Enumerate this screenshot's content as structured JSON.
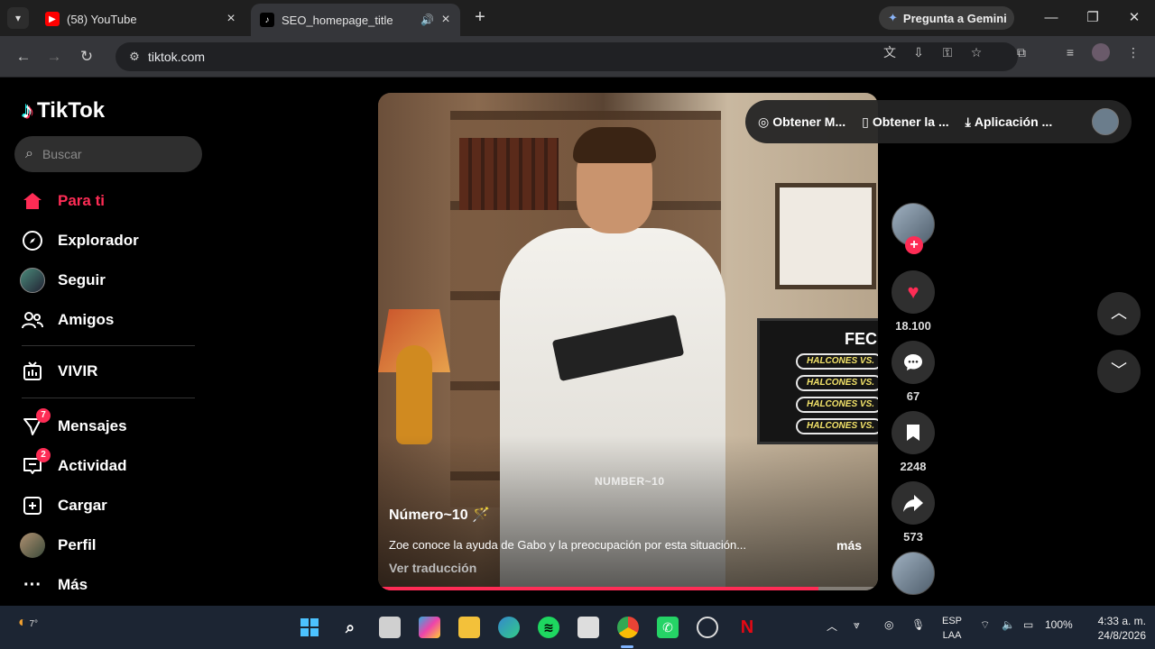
{
  "browser": {
    "tabs": [
      {
        "title": "(58) YouTube",
        "active": false
      },
      {
        "title": "SEO_homepage_title",
        "active": true
      }
    ],
    "gemini_label": "Pregunta a Gemini",
    "url": "tiktok.com"
  },
  "tiktok": {
    "logo": "TikTok",
    "search_placeholder": "Buscar",
    "nav": [
      {
        "label": "Para ti",
        "icon": "home-icon"
      },
      {
        "label": "Explorador",
        "icon": "compass-icon"
      },
      {
        "label": "Seguir",
        "icon": "following-avatar-icon"
      },
      {
        "label": "Amigos",
        "icon": "friends-icon"
      },
      {
        "label": "VIVIR",
        "icon": "live-icon"
      },
      {
        "label": "Mensajes",
        "icon": "send-icon",
        "badge": "7"
      },
      {
        "label": "Actividad",
        "icon": "activity-icon",
        "badge": "2"
      },
      {
        "label": "Cargar",
        "icon": "upload-icon"
      },
      {
        "label": "Perfil",
        "icon": "profile-avatar-icon"
      },
      {
        "label": "Más",
        "icon": "more-icon"
      }
    ],
    "header_actions": [
      {
        "label": "Obtener M...",
        "icon": "coin-icon"
      },
      {
        "label": "Obtener la ...",
        "icon": "phone-icon"
      },
      {
        "label": "Aplicación ...",
        "icon": "download-icon"
      }
    ],
    "video": {
      "title": "Número~10 🪄",
      "description": "Zoe conoce la ayuda de Gabo y la preocupación por esta situación...",
      "more": "más",
      "translate": "Ver traducción",
      "watermark": "NUMBER~10",
      "progress": 0.88,
      "tv_title": "FECH",
      "tv_rows": [
        "HALCONES",
        "HALCONES",
        "HALCONES",
        "HALCONES"
      ],
      "tv_row_suffix": "VS."
    },
    "stats": {
      "likes": "18.100",
      "comments": "67",
      "saves": "2248",
      "shares": "573"
    }
  },
  "taskbar": {
    "weather": "7°",
    "lang_top": "ESP",
    "lang_bottom": "LAA",
    "battery": "100%",
    "time": "4:33 a. m.",
    "date": "24/8/2026"
  },
  "colors": {
    "accent": "#fe2c55",
    "sidebar_bg": "#000000",
    "taskbar_bg": "#1c2533"
  }
}
